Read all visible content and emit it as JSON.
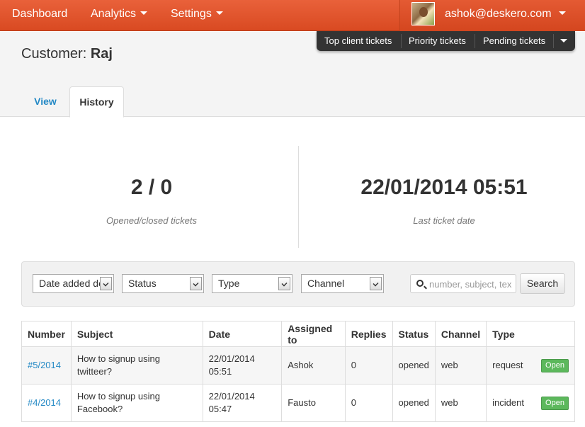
{
  "navbar": {
    "dashboard": "Dashboard",
    "analytics": "Analytics",
    "settings": "Settings",
    "user_email": "ashok@deskero.com"
  },
  "quick_tickets": {
    "top_client": "Top client tickets",
    "priority": "Priority tickets",
    "pending": "Pending tickets"
  },
  "page": {
    "title_prefix": "Customer:",
    "customer_name": "Raj"
  },
  "tabs": {
    "view": "View",
    "history": "History",
    "active": "History"
  },
  "stats": {
    "tickets_value": "2 / 0",
    "tickets_label": "Opened/closed tickets",
    "last_date_value": "22/01/2014 05:51",
    "last_date_label": "Last ticket date"
  },
  "filters": {
    "sort": "Date added de",
    "status": "Status",
    "type": "Type",
    "channel": "Channel",
    "search_placeholder": "number, subject, tex",
    "search_button": "Search"
  },
  "table": {
    "headers": [
      "Number",
      "Subject",
      "Date",
      "Assigned to",
      "Replies",
      "Status",
      "Channel",
      "Type"
    ],
    "rows": [
      {
        "number": "#5/2014",
        "subject": "How to signup using twitteer?",
        "date_line1": "22/01/2014",
        "date_line2": "05:51",
        "assigned_to": "Ashok",
        "replies": "0",
        "status": "opened",
        "channel": "web",
        "type": "request",
        "badge": "Open"
      },
      {
        "number": "#4/2014",
        "subject_line1": "How to signup using",
        "subject_line2": "Facebook?",
        "date_line1": "22/01/2014",
        "date_line2": "05:47",
        "assigned_to": "Fausto",
        "replies": "0",
        "status": "opened",
        "channel": "web",
        "type": "incident",
        "badge": "Open"
      }
    ]
  },
  "colors": {
    "navbar": "#e2542d",
    "link": "#2489c5",
    "badge_open": "#5cb85c",
    "quickbar": "#333333"
  }
}
